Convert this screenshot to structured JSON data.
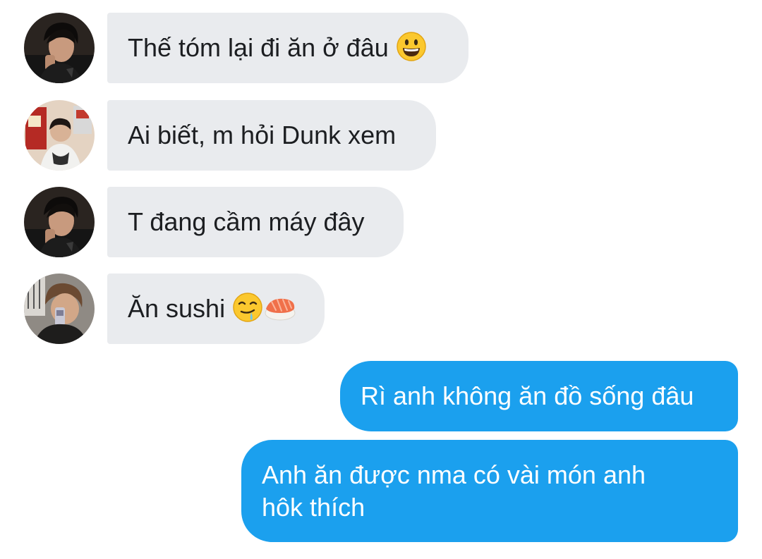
{
  "messages": [
    {
      "sender": "incoming",
      "avatar_icon": "avatar-dark-hair-icon",
      "text": "Thế tóm lại đi ăn ở đâu",
      "emojis": [
        "grinning-face-icon"
      ]
    },
    {
      "sender": "incoming",
      "avatar_icon": "avatar-shop-background-icon",
      "text": "Ai biết, m hỏi Dunk xem",
      "emojis": []
    },
    {
      "sender": "incoming",
      "avatar_icon": "avatar-dark-hair-icon",
      "text": "T đang cầm máy đây",
      "emojis": []
    },
    {
      "sender": "incoming",
      "avatar_icon": "avatar-mirror-selfie-icon",
      "text": "Ăn sushi",
      "emojis": [
        "drooling-face-icon",
        "sushi-icon"
      ]
    },
    {
      "sender": "outgoing",
      "text": "Rì anh không ăn đồ sống đâu"
    },
    {
      "sender": "outgoing",
      "text_line1": "Anh ăn được nma có vài món anh",
      "text_line2": "hôk thích"
    }
  ],
  "colors": {
    "incoming_bubble": "#e9ebee",
    "incoming_text": "#1c1e21",
    "outgoing_bubble": "#1ba0ee",
    "outgoing_text": "#ffffff"
  }
}
